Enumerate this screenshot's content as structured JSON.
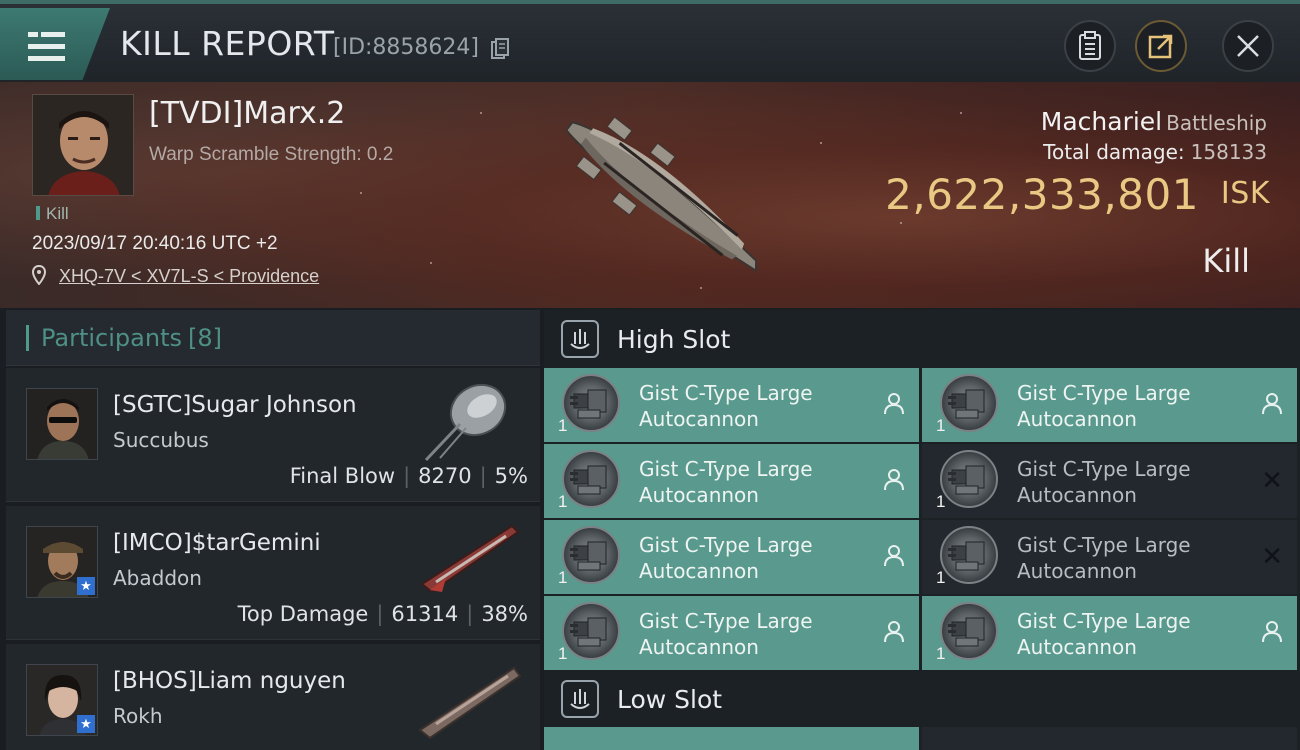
{
  "header": {
    "title": "KILL REPORT",
    "report_id": "[ID:8858624]"
  },
  "victim": {
    "name": "[TVDI]Marx.2",
    "scramble": "Warp Scramble Strength: 0.2",
    "tag": "Kill",
    "timestamp": "2023/09/17 20:40:16 UTC +2",
    "location": "XHQ-7V < XV7L-S < Providence",
    "ship": "Machariel",
    "ship_class": "Battleship",
    "damage_label": "Total damage:",
    "damage_value": "158133",
    "isk_value": "2,622,333,801",
    "isk_unit": "ISK",
    "result": "Kill"
  },
  "participants": {
    "label": "Participants",
    "count": "[8]",
    "items": [
      {
        "name": "[SGTC]Sugar Johnson",
        "ship": "Succubus",
        "stat_label": "Final Blow",
        "damage": "8270",
        "percent": "5%",
        "starred": false
      },
      {
        "name": "[IMCO]$tarGemini",
        "ship": "Abaddon",
        "stat_label": "Top Damage",
        "damage": "61314",
        "percent": "38%",
        "starred": true
      },
      {
        "name": "[BHOS]Liam nguyen",
        "ship": "Rokh",
        "stat_label": "",
        "damage": "",
        "percent": "",
        "starred": true
      }
    ]
  },
  "high_slot": {
    "label": "High Slot",
    "modules": [
      {
        "line1": "Gist C-Type Large",
        "line2": "Autocannon",
        "qty": "1",
        "state": "owned"
      },
      {
        "line1": "Gist C-Type Large",
        "line2": "Autocannon",
        "qty": "1",
        "state": "owned"
      },
      {
        "line1": "Gist C-Type Large",
        "line2": "Autocannon",
        "qty": "1",
        "state": "owned"
      },
      {
        "line1": "Gist C-Type Large",
        "line2": "Autocannon",
        "qty": "1",
        "state": "destroyed"
      },
      {
        "line1": "Gist C-Type Large",
        "line2": "Autocannon",
        "qty": "1",
        "state": "owned"
      },
      {
        "line1": "Gist C-Type Large",
        "line2": "Autocannon",
        "qty": "1",
        "state": "destroyed"
      },
      {
        "line1": "Gist C-Type Large",
        "line2": "Autocannon",
        "qty": "1",
        "state": "owned"
      },
      {
        "line1": "Gist C-Type Large",
        "line2": "Autocannon",
        "qty": "1",
        "state": "owned"
      }
    ]
  },
  "low_slot": {
    "label": "Low Slot"
  },
  "icons": {
    "menu": "hamburger-menu-icon",
    "copy": "copy-icon",
    "clipboard": "clipboard-icon",
    "share": "share-icon",
    "close": "close-icon",
    "location": "map-pin-icon",
    "slot": "slot-icon",
    "pilot": "person-icon",
    "destroyed": "x-icon"
  },
  "colors": {
    "accent": "#4e9a8b",
    "module_bg": "#5a9a8e",
    "isk": "#e8c882"
  }
}
